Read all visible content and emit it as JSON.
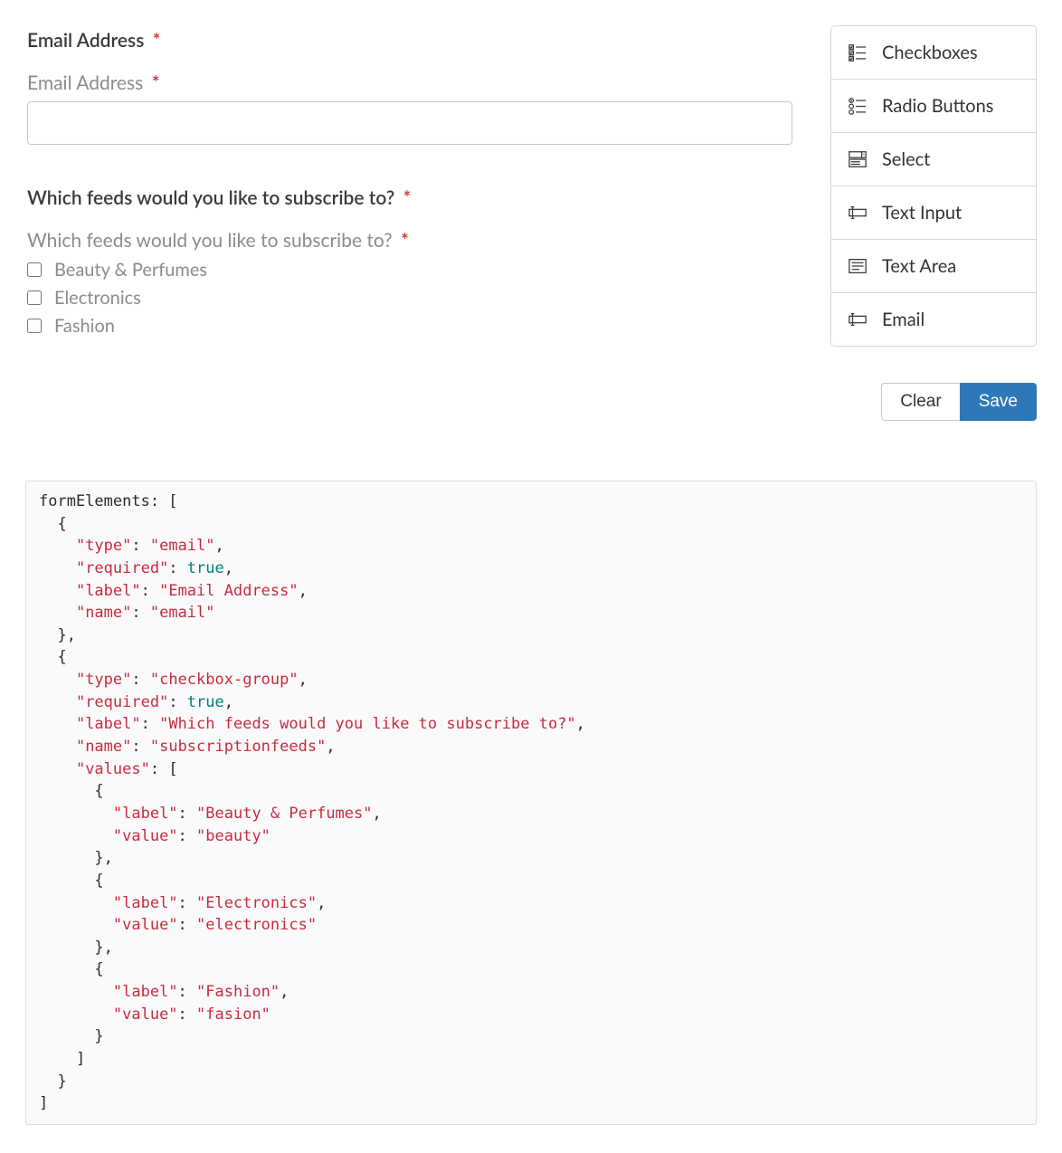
{
  "form": {
    "fields": [
      {
        "title": "Email Address",
        "preview_label": "Email Address",
        "required_mark": "*",
        "type": "email"
      },
      {
        "title": "Which feeds would you like to subscribe to?",
        "preview_label": "Which feeds would you like to subscribe to?",
        "required_mark": "*",
        "type": "checkbox-group",
        "options": [
          {
            "label": "Beauty & Perfumes"
          },
          {
            "label": "Electronics"
          },
          {
            "label": "Fashion"
          }
        ]
      }
    ]
  },
  "sidebar": {
    "items": [
      {
        "label": "Checkboxes",
        "icon": "checkboxes-icon"
      },
      {
        "label": "Radio Buttons",
        "icon": "radio-buttons-icon"
      },
      {
        "label": "Select",
        "icon": "select-icon"
      },
      {
        "label": "Text Input",
        "icon": "text-input-icon"
      },
      {
        "label": "Text Area",
        "icon": "text-area-icon"
      },
      {
        "label": "Email",
        "icon": "email-icon"
      }
    ]
  },
  "buttons": {
    "clear": "Clear",
    "save": "Save"
  },
  "code": {
    "pre": "formElements: [\n  {\n    ",
    "l0": "\"type\"",
    "l0v": "\"email\"",
    "l1": "\"required\"",
    "l1v": "true",
    "l2": "\"label\"",
    "l2v": "\"Email Address\"",
    "l3": "\"name\"",
    "l3v": "\"email\"",
    "mid1": "\n  },\n  {\n    ",
    "l4": "\"type\"",
    "l4v": "\"checkbox-group\"",
    "l5": "\"required\"",
    "l5v": "true",
    "l6": "\"label\"",
    "l6v": "\"Which feeds would you like to subscribe to?\"",
    "l7": "\"name\"",
    "l7v": "\"subscriptionfeeds\"",
    "l8": "\"values\"",
    "mid2": ": [\n      {\n        ",
    "v0": "\"label\"",
    "v0v": "\"Beauty & Perfumes\"",
    "v1": "\"value\"",
    "v1v": "\"beauty\"",
    "mid3": "\n      },\n      {\n        ",
    "v2": "\"label\"",
    "v2v": "\"Electronics\"",
    "v3": "\"value\"",
    "v3v": "\"electronics\"",
    "v4": "\"label\"",
    "v4v": "\"Fashion\"",
    "v5": "\"value\"",
    "v5v": "\"fasion\"",
    "post": "\n      }\n    ]\n  }\n]"
  }
}
